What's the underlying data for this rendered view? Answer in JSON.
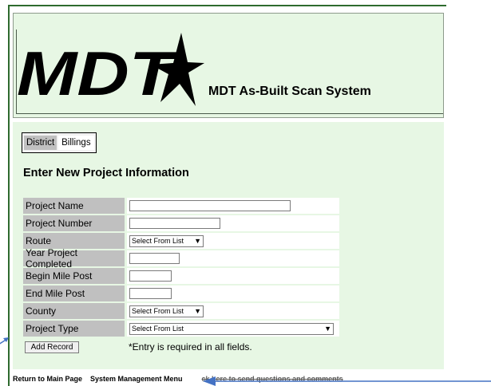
{
  "header": {
    "logo_text": "MDT",
    "app_title": "MDT As-Built Scan System"
  },
  "district": {
    "label": "District",
    "value": "Billings"
  },
  "form": {
    "title": "Enter New Project Information",
    "rows": [
      {
        "label": "Project Name",
        "type": "text"
      },
      {
        "label": "Project Number",
        "type": "text"
      },
      {
        "label": "Route",
        "type": "select",
        "value": "Select From List"
      },
      {
        "label": "Year Project Completed",
        "type": "text"
      },
      {
        "label": "Begin Mile Post",
        "type": "text"
      },
      {
        "label": "End Mile Post",
        "type": "text"
      },
      {
        "label": "County",
        "type": "select",
        "value": "Select From List"
      },
      {
        "label": "Project Type",
        "type": "select",
        "value": "Select From List"
      }
    ],
    "add_button": "Add Record",
    "required_note": "*Entry is required in all fields."
  },
  "footer": {
    "main_page": "Return to Main Page",
    "system_menu": "System Management Menu",
    "feedback": "ck here to send questions and comments"
  },
  "colors": {
    "panel_bg": "#e7f7e4",
    "label_bg": "#c0c0c0",
    "frame": "#2e6b2e",
    "annotation_arrow": "#4472c4"
  }
}
